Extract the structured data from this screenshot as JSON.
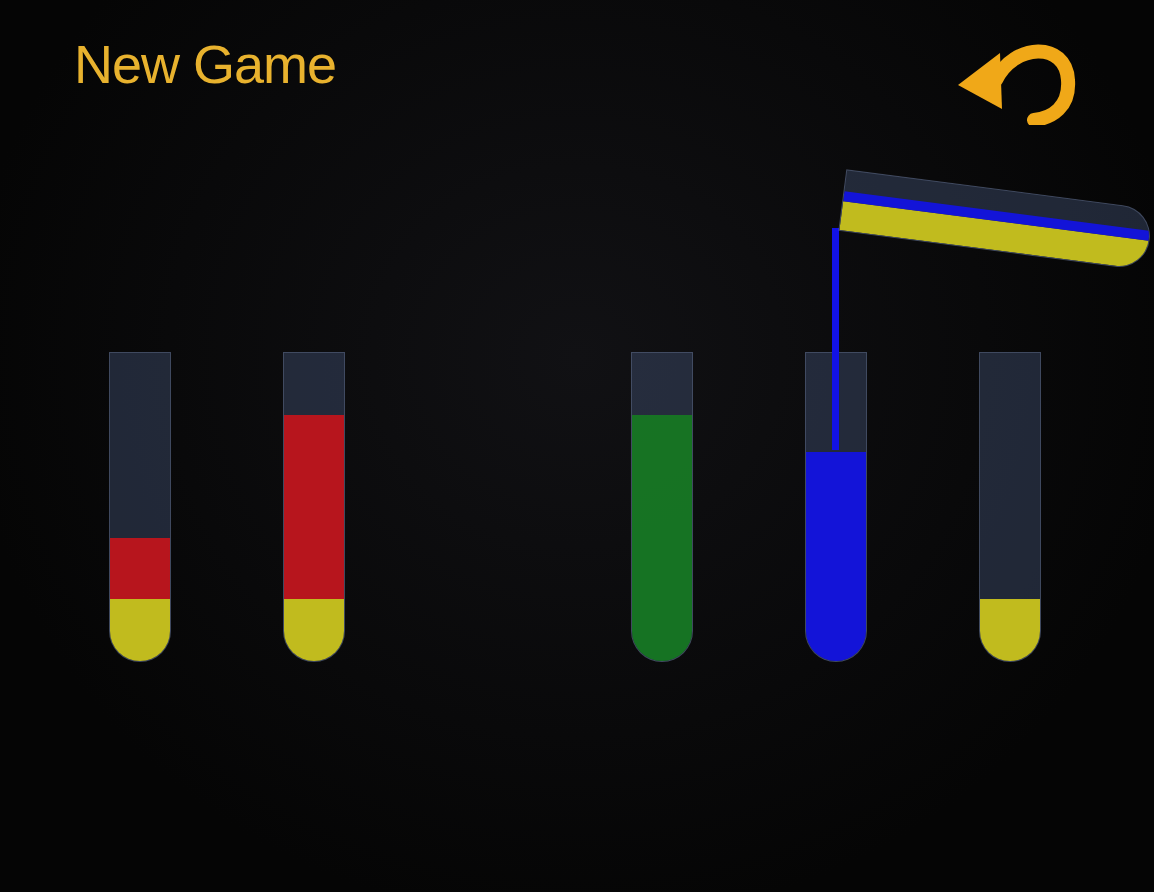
{
  "header": {
    "title": "New Game"
  },
  "tubes": [
    {
      "lifted": false,
      "pouring": false,
      "layers": [
        {
          "color": "#cfc81c",
          "level": 0.2
        },
        {
          "color": "#c4141b",
          "level": 0.2
        }
      ]
    },
    {
      "lifted": false,
      "pouring": false,
      "layers": [
        {
          "color": "#cfc81c",
          "level": 0.2
        },
        {
          "color": "#c4141b",
          "level": 0.6
        }
      ]
    },
    {
      "lifted": true,
      "pouring": true,
      "layers": [
        {
          "color": "#cfc81c",
          "level": 0.2
        },
        {
          "color": "#1212e6",
          "level": 0.07
        }
      ]
    },
    {
      "lifted": false,
      "pouring": false,
      "layers": [
        {
          "color": "#167a22",
          "level": 0.8
        }
      ]
    },
    {
      "lifted": false,
      "pouring": false,
      "layers": [
        {
          "color": "#1212e6",
          "level": 0.68
        }
      ]
    },
    {
      "lifted": false,
      "pouring": false,
      "layers": [
        {
          "color": "#cfc81c",
          "level": 0.2
        }
      ]
    }
  ]
}
